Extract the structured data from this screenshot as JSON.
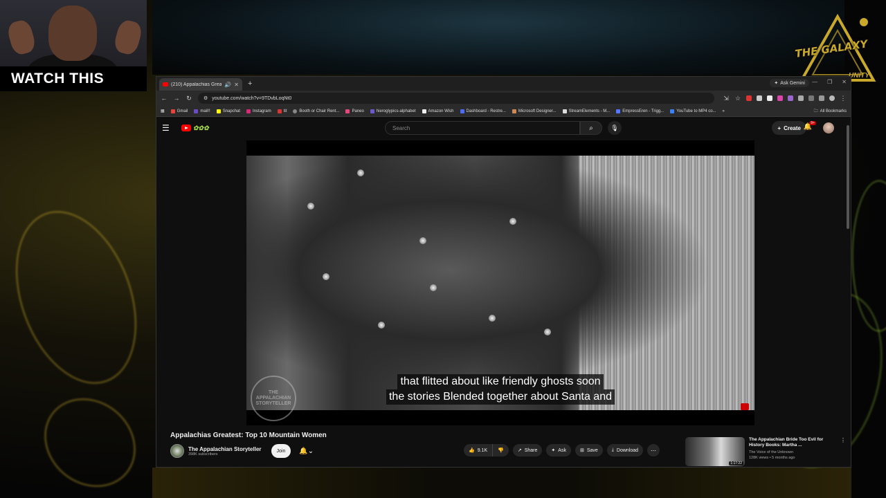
{
  "overlay": {
    "watch_label": "WATCH THIS",
    "logo_text": "THE GALAXY",
    "logo_sub": "UNITY"
  },
  "browser": {
    "tab_title": "(210) Appalachias Greatest:",
    "url": "youtube.com/watch?v=9TDvbLoqNt0",
    "ask_gemini": "Ask Gemini",
    "bookmarks": [
      "Gmail",
      "mail!!",
      "Snapchat",
      "Instagram",
      "tit",
      "Booth or Chair Rent...",
      "Paneo",
      "hieroglypics-alphabet",
      "Amazon Wish",
      "Dashboard - Restre...",
      "Microsoft Designer...",
      "StreamElements - M...",
      "EmpressEren - Trigg...",
      "YouTube to MP4 co..."
    ],
    "all_bookmarks": "All Bookmarks"
  },
  "youtube": {
    "search_placeholder": "Search",
    "create_label": "Create",
    "notif_count": "9+",
    "caption_line1": "that flitted about like friendly ghosts soon",
    "caption_line2": "the stories Blended together about Santa and",
    "watermark": "THE APPALACHIAN STORYTELLER",
    "video_title": "Appalachias Greatest: Top 10 Mountain Women",
    "channel_name": "The Appalachian Storyteller",
    "channel_subs": "398K subscribers",
    "join_label": "Join",
    "like_count": "9.1K",
    "share_label": "Share",
    "ask_label": "Ask",
    "save_label": "Save",
    "download_label": "Download",
    "rec": {
      "title": "The Appalachian Bride Too Evil for History Books: Martha ...",
      "channel": "The Voice of the Unknown",
      "stats": "128K views • 5 months ago",
      "duration": "1:17:22"
    }
  },
  "colors": {
    "youtube_red": "#ff0000",
    "galaxy_gold": "#c9a92c",
    "dark_bg": "#0f0f0f"
  }
}
